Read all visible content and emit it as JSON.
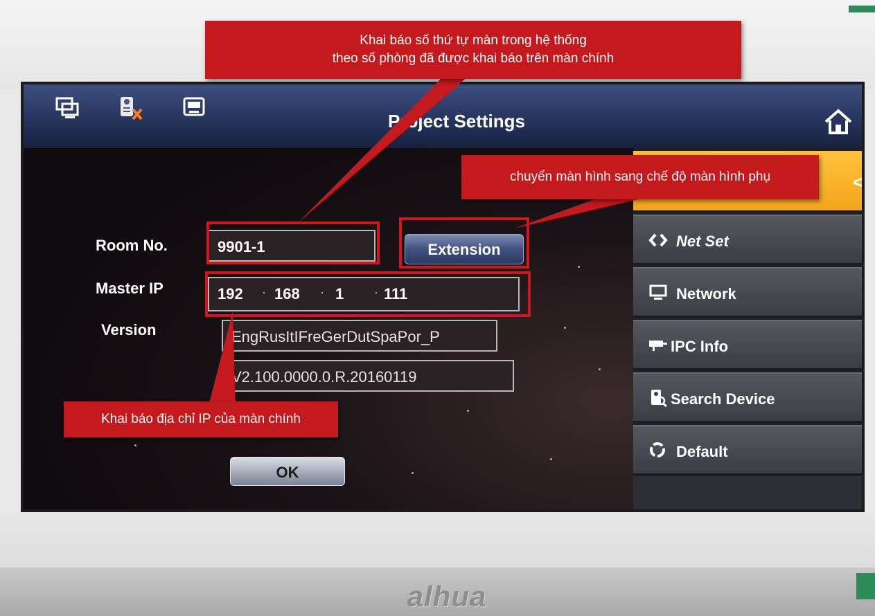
{
  "device": {
    "brand": "alhua"
  },
  "screen": {
    "title": "Project Settings"
  },
  "form": {
    "room_no_label": "Room No.",
    "room_no_value": "9901-1",
    "extension_button": "Extension",
    "master_ip_label": "Master IP",
    "master_ip": [
      "192",
      "168",
      "1",
      "111"
    ],
    "version_label": "Version",
    "version_line1": "EngRusItIFreGerDutSpaPor_P",
    "version_line2": "V2.100.0000.0.R.20160119",
    "ok_button": "OK"
  },
  "side_menu": {
    "items": [
      {
        "label": "Net Set",
        "icon": "code-brackets-icon"
      },
      {
        "label": "Network",
        "icon": "monitor-icon"
      },
      {
        "label": "IPC Info",
        "icon": "camera-icon"
      },
      {
        "label": "Search Device",
        "icon": "search-device-icon"
      },
      {
        "label": "Default",
        "icon": "recycle-icon"
      }
    ]
  },
  "annotations": {
    "room_note_line1": "Khai báo số thứ tự màn trong hệ thống",
    "room_note_line2": "theo số phòng  đã được khai báo trên màn chính",
    "extension_note": "chuyển màn hình sang chế độ màn hình phụ",
    "ip_note": "Khai báo địa chỉ IP của màn chính"
  },
  "colors": {
    "annotation_red": "#c4191d",
    "active_tab": "#f3a51a",
    "title_bar": "#26355d"
  }
}
